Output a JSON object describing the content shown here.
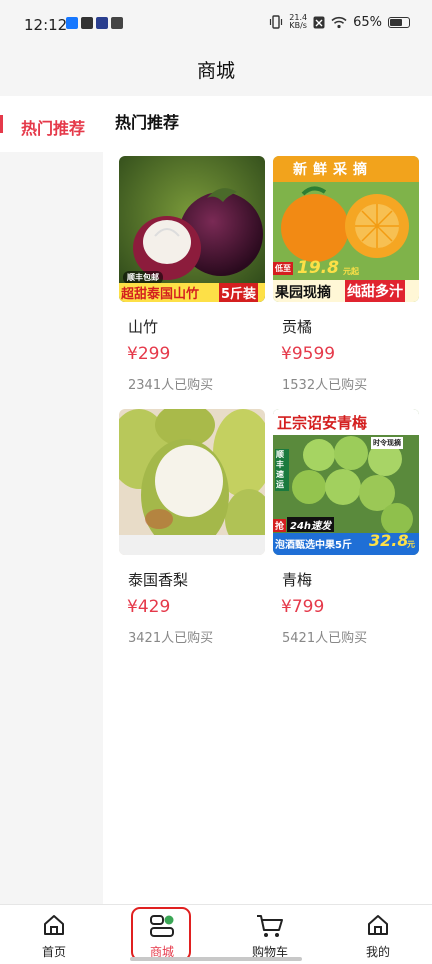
{
  "status_bar": {
    "time": "12:12",
    "net_speed_value": "21.4",
    "net_speed_unit": "KB/s",
    "battery": "65%"
  },
  "header": {
    "title": "商城"
  },
  "sidebar": {
    "items": [
      {
        "label": "热门推荐",
        "active": true
      }
    ]
  },
  "section": {
    "title": "热门推荐"
  },
  "products": [
    {
      "name": "山竹",
      "price": "¥299",
      "sales": "2341人已购买",
      "banner": {
        "badge": "顺丰包邮",
        "main": "超甜泰国山竹",
        "accent": "5斤装"
      }
    },
    {
      "name": "贡橘",
      "price": "¥9599",
      "sales": "1532人已购买",
      "banner": {
        "top": "新鲜采摘",
        "price_prefix": "低至",
        "price": "19.8",
        "price_suffix": "元起",
        "line1": "果园现摘",
        "line2": "纯甜多汁"
      }
    },
    {
      "name": "泰国香梨",
      "price": "¥429",
      "sales": "3421人已购买",
      "banner": {}
    },
    {
      "name": "青梅",
      "price": "¥799",
      "sales": "5421人已购买",
      "banner": {
        "top": "正宗诏安青梅",
        "tag1": "时令现摘",
        "tag2": "顺丰速运",
        "tag3": "抢",
        "tag4": "24h速发",
        "bottom": "泡酒甄选中果5斤",
        "price": "32.8",
        "unit": "元"
      }
    }
  ],
  "bottom_nav": {
    "items": [
      {
        "label": "首页",
        "icon": "home-icon"
      },
      {
        "label": "商城",
        "icon": "shop-icon",
        "active": true
      },
      {
        "label": "购物车",
        "icon": "cart-icon"
      },
      {
        "label": "我的",
        "icon": "profile-icon"
      }
    ]
  },
  "colors": {
    "accent": "#e5394a",
    "highlight_ring": "#e02020"
  }
}
